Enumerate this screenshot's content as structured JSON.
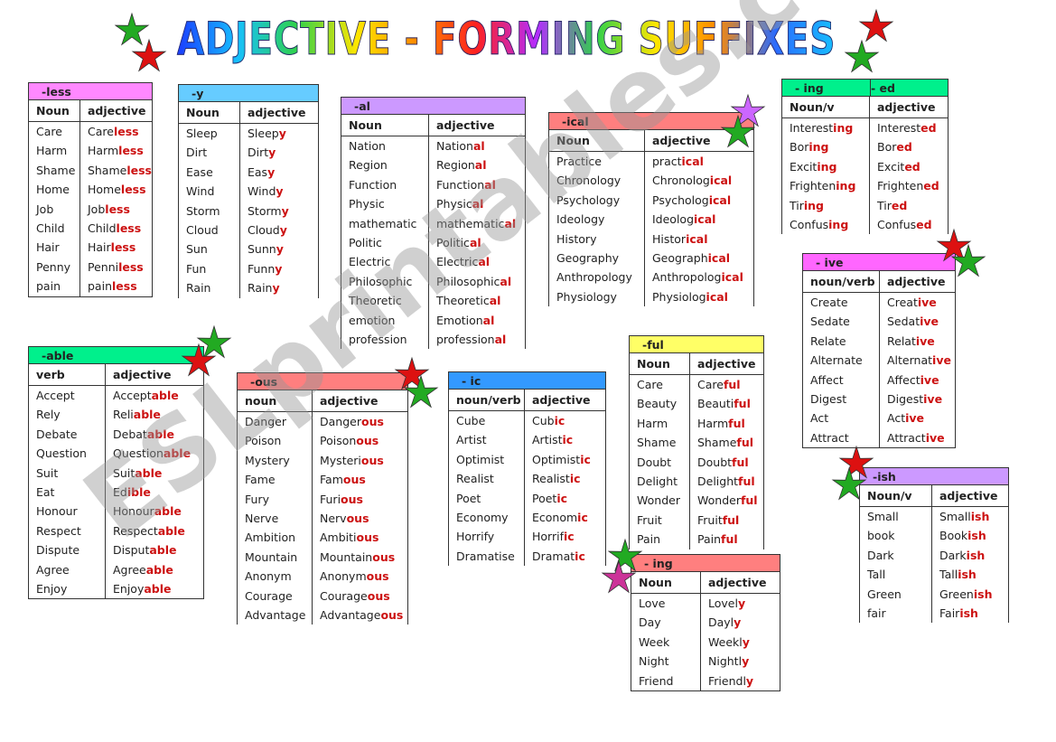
{
  "title": "ADJECTIVE - FORMING SUFFIXES",
  "watermark": "ESLprintables.com",
  "colors": {
    "suffix": "#cc1111",
    "less": "#ff88ff",
    "y": "#66ccff",
    "al": "#cc99ff",
    "ical": "#ff7f7f",
    "ing_ed": "#00f08c",
    "ive": "#ff66ff",
    "able": "#00f08c",
    "ous": "#ff7f7f",
    "ic": "#3399ff",
    "ful": "#ffff66",
    "ly": "#ff7f7f",
    "ish": "#cc99ff"
  },
  "tables": [
    {
      "id": "less",
      "header": [
        "-less"
      ],
      "cols": [
        "Noun",
        "adjective"
      ],
      "rows": [
        [
          "Care",
          "Care",
          "less"
        ],
        [
          "Harm",
          "Harm",
          "less"
        ],
        [
          "Shame",
          "Shame",
          "less"
        ],
        [
          "Home",
          "Home",
          "less"
        ],
        [
          "Job",
          "Job",
          "less"
        ],
        [
          "Child",
          "Child",
          "less"
        ],
        [
          "Hair",
          "Hair",
          "less"
        ],
        [
          "Penny",
          "Penni",
          "less"
        ],
        [
          "pain",
          "pain",
          "less"
        ]
      ]
    },
    {
      "id": "y",
      "header": [
        "-y"
      ],
      "cols": [
        "Noun",
        "adjective"
      ],
      "rows": [
        [
          "Sleep",
          "Sleep",
          "y"
        ],
        [
          "Dirt",
          "Dirt",
          "y"
        ],
        [
          "Ease",
          "Eas",
          "y"
        ],
        [
          "Wind",
          "Wind",
          "y"
        ],
        [
          "Storm",
          "Storm",
          "y"
        ],
        [
          "Cloud",
          "Cloud",
          "y"
        ],
        [
          "Sun",
          "Sunn",
          "y"
        ],
        [
          "Fun",
          "Funn",
          "y"
        ],
        [
          "Rain",
          "Rain",
          "y"
        ]
      ]
    },
    {
      "id": "al",
      "header": [
        "-al"
      ],
      "cols": [
        "Noun",
        "adjective"
      ],
      "rows": [
        [
          "Nation",
          "Nation",
          "al"
        ],
        [
          "Region",
          "Region",
          "al"
        ],
        [
          "Function",
          "Function",
          "al"
        ],
        [
          "Physic",
          "Physic",
          "al"
        ],
        [
          "mathematic",
          "mathematic",
          "al"
        ],
        [
          "Politic",
          "Politic",
          "al"
        ],
        [
          "Electric",
          "Electric",
          "al"
        ],
        [
          "Philosophic",
          "Philosophic",
          "al"
        ],
        [
          "Theoretic",
          "Theoretic",
          "al"
        ],
        [
          "emotion",
          "Emotion",
          "al"
        ],
        [
          "profession",
          "profession",
          "al"
        ]
      ]
    },
    {
      "id": "ical",
      "header": [
        "-ical"
      ],
      "cols": [
        "Noun",
        "adjective"
      ],
      "rows": [
        [
          "Practice",
          "pract",
          "ical"
        ],
        [
          "Chronology",
          "Chronolog",
          "ical"
        ],
        [
          "Psychology",
          "Psycholog",
          "ical"
        ],
        [
          "Ideology",
          "Ideolog",
          "ical"
        ],
        [
          "History",
          "Histor",
          "ical"
        ],
        [
          "Geography",
          "Geograph",
          "ical"
        ],
        [
          "Anthropology",
          "Anthropolog",
          "ical"
        ],
        [
          "Physiology",
          "Physiolog",
          "ical"
        ]
      ]
    },
    {
      "id": "ing_ed",
      "header": [
        "- ing",
        "-      ed"
      ],
      "cols": [
        "Noun/v",
        "adjective"
      ],
      "rows": [
        [
          "Interest|ing",
          "Interest",
          "ed"
        ],
        [
          "Bor|ing",
          "Bor",
          "ed"
        ],
        [
          "Excit|ing",
          "Excit",
          "ed"
        ],
        [
          "Frighten|ing",
          "Frighten",
          "ed"
        ],
        [
          "Tir|ing",
          "Tir",
          "ed"
        ],
        [
          "Confus|ing",
          "Confus",
          "ed"
        ]
      ]
    },
    {
      "id": "ive",
      "header": [
        "- ive"
      ],
      "cols": [
        "noun/verb",
        "adjective"
      ],
      "rows": [
        [
          "Create",
          "Creat",
          "ive"
        ],
        [
          "Sedate",
          "Sedat",
          "ive"
        ],
        [
          "Relate",
          "Relat",
          "ive"
        ],
        [
          "Alternate",
          "Alternat",
          "ive"
        ],
        [
          "Affect",
          "Affect",
          "ive"
        ],
        [
          "Digest",
          "Digest",
          "ive"
        ],
        [
          "Act",
          "Act",
          "ive"
        ],
        [
          "Attract",
          "Attract",
          "ive"
        ]
      ]
    },
    {
      "id": "able",
      "header": [
        "-able"
      ],
      "cols": [
        "verb",
        "adjective"
      ],
      "rows": [
        [
          "Accept",
          "Accept",
          "able"
        ],
        [
          "Rely",
          "Reli",
          "able"
        ],
        [
          "Debate",
          "Debat",
          "able"
        ],
        [
          "Question",
          "Question",
          "able"
        ],
        [
          "Suit",
          "Suit",
          "able"
        ],
        [
          "Eat",
          "Ed",
          "ible"
        ],
        [
          "Honour",
          "Honour",
          "able"
        ],
        [
          "Respect",
          "Respect",
          "able"
        ],
        [
          "Dispute",
          "Disput",
          "able"
        ],
        [
          "Agree",
          "Agree",
          "able"
        ],
        [
          "Enjoy",
          "Enjoy",
          "able"
        ]
      ]
    },
    {
      "id": "ous",
      "header": [
        "-ous"
      ],
      "cols": [
        "noun",
        "adjective"
      ],
      "rows": [
        [
          "Danger",
          "Danger",
          "ous"
        ],
        [
          "Poison",
          "Poison",
          "ous"
        ],
        [
          "Mystery",
          "Mysteri",
          "ous"
        ],
        [
          "Fame",
          "Fam",
          "ous"
        ],
        [
          "Fury",
          "Furi",
          "ous"
        ],
        [
          "Nerve",
          "Nerv",
          "ous"
        ],
        [
          "Ambition",
          "Ambiti",
          "ous"
        ],
        [
          "Mountain",
          "Mountain",
          "ous"
        ],
        [
          "Anonym",
          "Anonym",
          "ous"
        ],
        [
          "Courage",
          "Courage",
          "ous"
        ],
        [
          "Advantage",
          "Advantage",
          "ous"
        ]
      ]
    },
    {
      "id": "ic",
      "header": [
        "-  ic"
      ],
      "cols": [
        "noun/verb",
        "adjective"
      ],
      "rows": [
        [
          "Cube",
          "Cub",
          "ic"
        ],
        [
          "Artist",
          "Artist",
          "ic"
        ],
        [
          "Optimist",
          "Optimist",
          "ic"
        ],
        [
          "Realist",
          "Realist",
          "ic"
        ],
        [
          "Poet",
          "Poet",
          "ic"
        ],
        [
          "Economy",
          "Econom",
          "ic"
        ],
        [
          "Horrify",
          "Horrif",
          "ic"
        ],
        [
          "Dramatise",
          "Dramat",
          "ic"
        ]
      ]
    },
    {
      "id": "ful",
      "header": [
        "-ful"
      ],
      "cols": [
        "Noun",
        "adjective"
      ],
      "rows": [
        [
          "Care",
          "Care",
          "ful"
        ],
        [
          "Beauty",
          "Beauti",
          "ful"
        ],
        [
          "Harm",
          "Harm",
          "ful"
        ],
        [
          "Shame",
          "Shame",
          "ful"
        ],
        [
          "Doubt",
          "Doubt",
          "ful"
        ],
        [
          "Delight",
          "Delight",
          "ful"
        ],
        [
          "Wonder",
          "Wonder",
          "ful"
        ],
        [
          "Fruit",
          "Fruit",
          "ful"
        ],
        [
          "Pain",
          "Pain",
          "ful"
        ]
      ]
    },
    {
      "id": "ly",
      "header": [
        "- ing"
      ],
      "cols": [
        "Noun",
        "adjective"
      ],
      "rows": [
        [
          "Love",
          "Lovel",
          "y"
        ],
        [
          "Day",
          "Dayl",
          "y"
        ],
        [
          "Week",
          "Weekl",
          "y"
        ],
        [
          "Night",
          "Nightl",
          "y"
        ],
        [
          "Friend",
          "Friendl",
          "y"
        ]
      ]
    },
    {
      "id": "ish",
      "header": [
        "-ish"
      ],
      "cols": [
        "Noun/v",
        "adjective"
      ],
      "rows": [
        [
          "Small",
          "Small",
          "ish"
        ],
        [
          "book",
          "Book",
          "ish"
        ],
        [
          "Dark",
          "Dark",
          "ish"
        ],
        [
          "Tall",
          "Tall",
          "ish"
        ],
        [
          "Green",
          "Green",
          "ish"
        ],
        [
          "fair",
          "Fair",
          "ish"
        ]
      ]
    }
  ]
}
